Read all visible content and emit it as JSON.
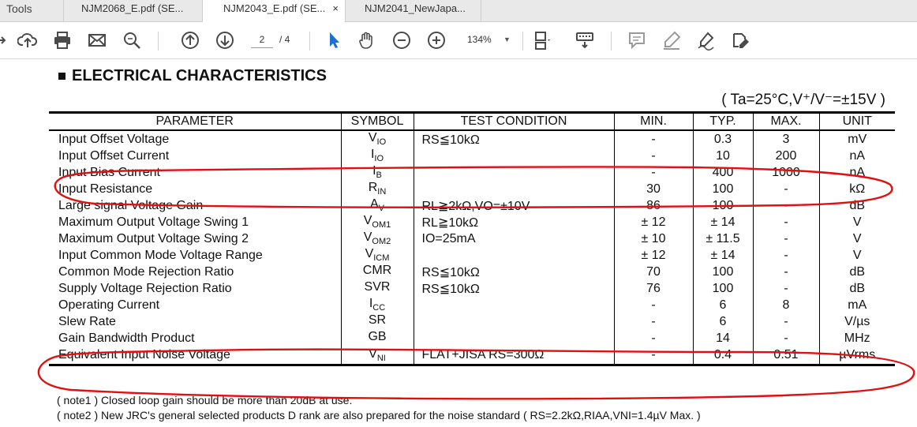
{
  "tabs": {
    "tools": "Tools",
    "t1": "NJM2068_E.pdf (SE...",
    "t2": "NJM2043_E.pdf (SE...",
    "t2_close": "×",
    "t3": "NJM2041_NewJapa..."
  },
  "toolbar": {
    "page_current": "2",
    "page_total": "/ 4",
    "zoom": "134%",
    "zoom_caret": "▼"
  },
  "doc": {
    "heading": "ELECTRICAL CHARACTERISTICS",
    "conditions": "( Ta=25°C,V⁺/V⁻=±15V )",
    "columns": [
      "PARAMETER",
      "SYMBOL",
      "TEST CONDITION",
      "MIN.",
      "TYP.",
      "MAX.",
      "UNIT"
    ],
    "rows": [
      {
        "p": "Input Offset Voltage",
        "s": "V",
        "ss": "IO",
        "c": "RS≦10kΩ",
        "min": "-",
        "typ": "0.3",
        "max": "3",
        "unit": "mV"
      },
      {
        "p": "Input Offset Current",
        "s": "I",
        "ss": "IO",
        "c": "",
        "min": "-",
        "typ": "10",
        "max": "200",
        "unit": "nA"
      },
      {
        "p": "Input Bias Current",
        "s": "I",
        "ss": "B",
        "c": "",
        "min": "-",
        "typ": "400",
        "max": "1000",
        "unit": "nA"
      },
      {
        "p": "Input Resistance",
        "s": "R",
        "ss": "IN",
        "c": "",
        "min": "30",
        "typ": "100",
        "max": "-",
        "unit": "kΩ"
      },
      {
        "p": "Large signal Voltage Gain",
        "s": "A",
        "ss": "V",
        "c": "RL≧2kΩ,VO=±10V",
        "min": "86",
        "typ": "100",
        "max": "-",
        "unit": "dB"
      },
      {
        "p": "Maximum Output Voltage Swing 1",
        "s": "V",
        "ss": "OM1",
        "c": "RL≧10kΩ",
        "min": "± 12",
        "typ": "± 14",
        "max": "-",
        "unit": "V"
      },
      {
        "p": "Maximum Output Voltage Swing 2",
        "s": "V",
        "ss": "OM2",
        "c": "IO=25mA",
        "min": "± 10",
        "typ": "± 11.5",
        "max": "-",
        "unit": "V"
      },
      {
        "p": "Input Common Mode Voltage Range",
        "s": "V",
        "ss": "ICM",
        "c": "",
        "min": "± 12",
        "typ": "± 14",
        "max": "-",
        "unit": "V"
      },
      {
        "p": "Common Mode Rejection Ratio",
        "s": "CMR",
        "ss": "",
        "c": "RS≦10kΩ",
        "min": "70",
        "typ": "100",
        "max": "-",
        "unit": "dB"
      },
      {
        "p": "Supply Voltage Rejection Ratio",
        "s": "SVR",
        "ss": "",
        "c": "RS≦10kΩ",
        "min": "76",
        "typ": "100",
        "max": "-",
        "unit": "dB"
      },
      {
        "p": "Operating Current",
        "s": "I",
        "ss": "CC",
        "c": "",
        "min": "-",
        "typ": "6",
        "max": "8",
        "unit": "mA"
      },
      {
        "p": "Slew Rate",
        "s": "SR",
        "ss": "",
        "c": "",
        "min": "-",
        "typ": "6",
        "max": "-",
        "unit": "V/µs"
      },
      {
        "p": "Gain Bandwidth Product",
        "s": "GB",
        "ss": "",
        "c": "",
        "min": "-",
        "typ": "14",
        "max": "-",
        "unit": "MHz"
      },
      {
        "p": "Equivalent Input Noise Voltage",
        "s": "V",
        "ss": "NI",
        "c": "FLAT+JISA RS=300Ω",
        "min": "-",
        "typ": "0.4",
        "max": "0.51",
        "unit": "µVrms"
      }
    ],
    "note1": "( note1 ) Closed loop gain should be more than 20dB at use.",
    "note2": "( note2 ) New JRC's general selected products D rank are also prepared for the noise standard ( RS=2.2kΩ,RIAA,VNI=1.4µV Max. )"
  },
  "colors": {
    "annotation_red": "#e01010"
  }
}
